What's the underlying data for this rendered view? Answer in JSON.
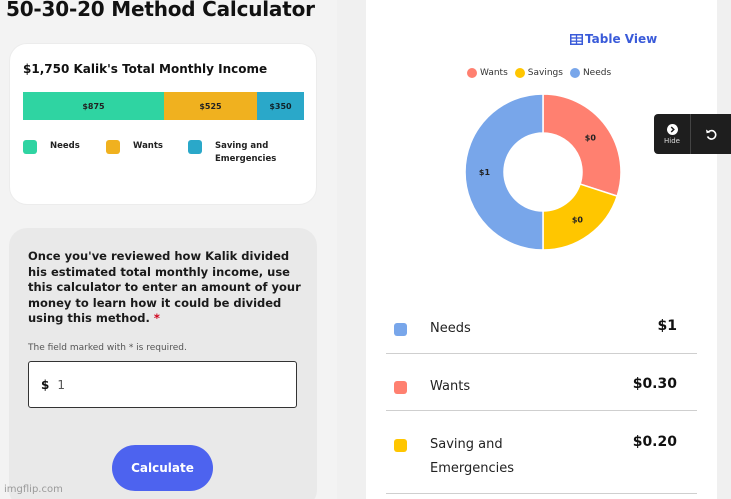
{
  "page": {
    "title": "50-30-20 Method Calculator"
  },
  "income_card": {
    "title": "$1,750 Kalik's Total Monthly Income",
    "bar": {
      "needs": "$875",
      "wants": "$525",
      "saving": "$350"
    },
    "legend": {
      "needs": "Needs",
      "wants": "Wants",
      "saving_line1": "Saving and",
      "saving_line2": "Emergencies"
    }
  },
  "form": {
    "instructions": "Once you've reviewed how Kalik divided his estimated total monthly income, use this calculator to enter an amount of your money to learn how it could be divided using this method.",
    "required_star": "*",
    "note": "The field marked with * is required.",
    "currency": "$",
    "amount_value": "1",
    "calculate_label": "Calculate"
  },
  "chart_panel": {
    "table_view_label": "Table View",
    "legend": [
      "Wants",
      "Savings",
      "Needs"
    ],
    "colors": {
      "wants": "#ff8070",
      "savings": "#ffc600",
      "needs": "#78a6ea"
    }
  },
  "chart_data": {
    "type": "pie",
    "categories": [
      "Needs",
      "Wants",
      "Savings"
    ],
    "values": [
      0.5,
      0.3,
      0.2
    ],
    "slice_labels": [
      "$1",
      "$0",
      "$0"
    ],
    "legend_placement": "top",
    "donut": true
  },
  "summary": {
    "needs_label": "Needs",
    "needs_value": "$1",
    "wants_label": "Wants",
    "wants_value": "$0.30",
    "saving_label_1": "Saving and",
    "saving_label_2": "Emergencies",
    "saving_value": "$0.20"
  },
  "toolbar": {
    "hide_label": "Hide"
  },
  "watermark": "imgflip.com"
}
